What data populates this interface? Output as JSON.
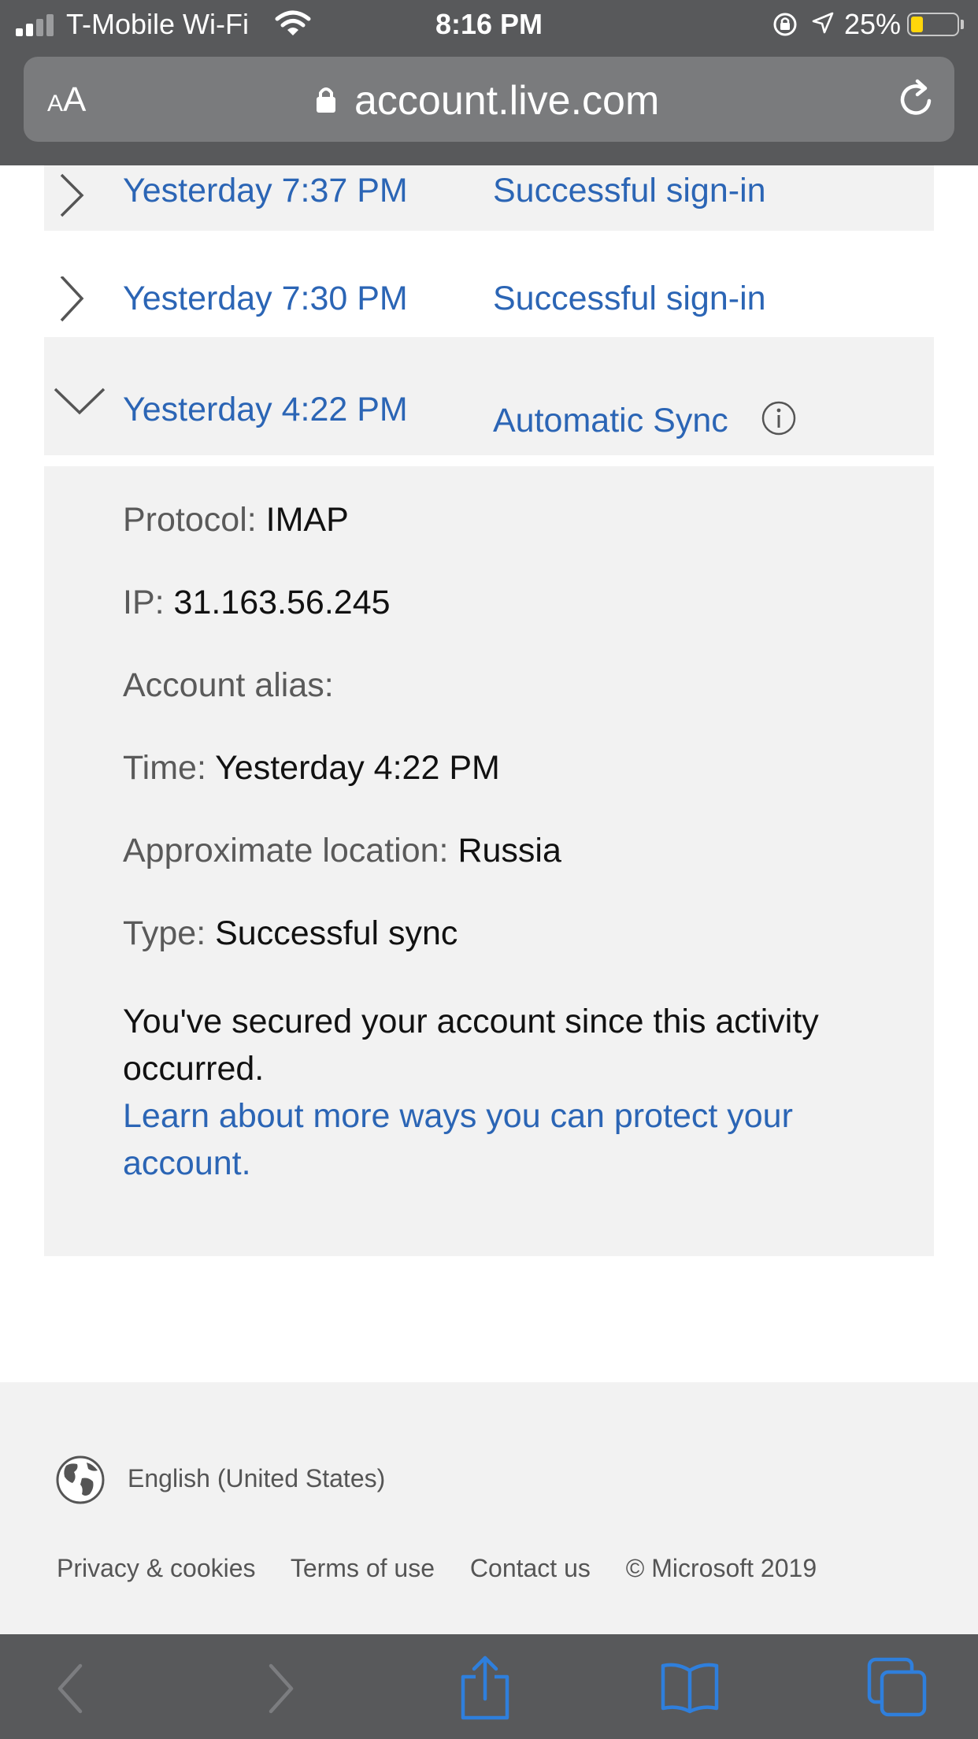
{
  "status_bar": {
    "carrier": "T-Mobile Wi-Fi",
    "time": "8:16 PM",
    "battery_percent": "25%",
    "battery_level": 0.25,
    "battery_color": "#ffd60a"
  },
  "browser": {
    "text_size_small": "A",
    "text_size_large": "A",
    "url": "account.live.com"
  },
  "activity": [
    {
      "date": "Yesterday 7:37 PM",
      "type": "Successful sign-in",
      "expanded": false
    },
    {
      "date": "Yesterday 7:30 PM",
      "type": "Successful sign-in",
      "expanded": false
    },
    {
      "date": "Yesterday 4:22 PM",
      "type": "Automatic Sync",
      "expanded": true
    }
  ],
  "details": {
    "protocol_label": "Protocol:",
    "protocol_value": "IMAP",
    "ip_label": "IP:",
    "ip_value": "31.163.56.245",
    "alias_label": "Account alias:",
    "alias_value": "",
    "time_label": "Time:",
    "time_value": "Yesterday 4:22 PM",
    "location_label": "Approximate location:",
    "location_value": "Russia",
    "type_label": "Type:",
    "type_value": "Successful sync",
    "notice": "You've secured your account since this activity occurred.",
    "learn_more": "Learn about more ways you can protect your account."
  },
  "footer": {
    "language": "English (United States)",
    "links": [
      "Privacy & cookies",
      "Terms of use",
      "Contact us"
    ],
    "copyright": "© Microsoft 2019"
  },
  "colors": {
    "link_blue": "#2b65b5",
    "row_highlight": "#f2f2f2",
    "chrome_gray": "#58595b",
    "toolbar_blue": "#2f7fdc"
  },
  "icons": {
    "expand": "chevron-right-icon",
    "collapse": "chevron-down-icon",
    "info": "info-icon",
    "language": "globe-icon",
    "back": "back-arrow-icon",
    "forward": "forward-arrow-icon",
    "share": "share-icon",
    "bookmarks": "bookmarks-icon",
    "tabs": "tabs-icon"
  }
}
